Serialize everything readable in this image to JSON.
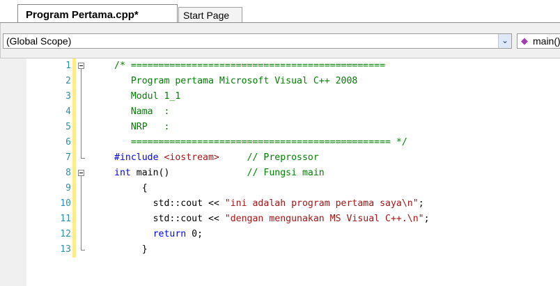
{
  "tabs": [
    {
      "label": "Program Pertama.cpp*",
      "active": true
    },
    {
      "label": "Start Page",
      "active": false
    }
  ],
  "navbar": {
    "scope": "(Global Scope)",
    "member": "main()",
    "dropdown_icon": "chevron-down-icon",
    "member_icon": "function-icon"
  },
  "lines": [
    {
      "n": "1",
      "segments": [
        {
          "t": "/* ==============================================",
          "c": "cm"
        }
      ]
    },
    {
      "n": "2",
      "segments": [
        {
          "t": "   Program pertama Microsoft Visual C++ 2008",
          "c": "cm"
        }
      ]
    },
    {
      "n": "3",
      "segments": [
        {
          "t": "   Modul 1_1",
          "c": "cm"
        }
      ]
    },
    {
      "n": "4",
      "segments": [
        {
          "t": "   Nama  :",
          "c": "cm"
        }
      ]
    },
    {
      "n": "5",
      "segments": [
        {
          "t": "   NRP   :",
          "c": "cm"
        }
      ]
    },
    {
      "n": "6",
      "segments": [
        {
          "t": "   =============================================== */",
          "c": "cm"
        }
      ]
    },
    {
      "n": "7",
      "segments": [
        {
          "t": "#include ",
          "c": "kw"
        },
        {
          "t": "<iostream>",
          "c": "st"
        },
        {
          "t": "     ",
          "c": ""
        },
        {
          "t": "// Preprossor",
          "c": "cm"
        }
      ]
    },
    {
      "n": "8",
      "segments": [
        {
          "t": "int",
          "c": "kw"
        },
        {
          "t": " main()              ",
          "c": ""
        },
        {
          "t": "// Fungsi main",
          "c": "cm"
        }
      ]
    },
    {
      "n": "9",
      "segments": [
        {
          "t": "     {",
          "c": ""
        }
      ]
    },
    {
      "n": "10",
      "segments": [
        {
          "t": "       std::cout << ",
          "c": ""
        },
        {
          "t": "\"ini adalah program pertama saya\\n\"",
          "c": "st"
        },
        {
          "t": ";",
          "c": ""
        }
      ]
    },
    {
      "n": "11",
      "segments": [
        {
          "t": "       std::cout << ",
          "c": ""
        },
        {
          "t": "\"dengan mengunakan MS Visual C++.\\n\"",
          "c": "st"
        },
        {
          "t": ";",
          "c": ""
        }
      ]
    },
    {
      "n": "12",
      "segments": [
        {
          "t": "       ",
          "c": ""
        },
        {
          "t": "return",
          "c": "kw"
        },
        {
          "t": " 0;",
          "c": ""
        }
      ]
    },
    {
      "n": "13",
      "segments": [
        {
          "t": "     }",
          "c": ""
        }
      ]
    }
  ],
  "colors": {
    "comment": "#008000",
    "keyword": "#0000ff",
    "string": "#a31515",
    "line_number": "#2b91af",
    "change_bar": "#ffec8b"
  }
}
